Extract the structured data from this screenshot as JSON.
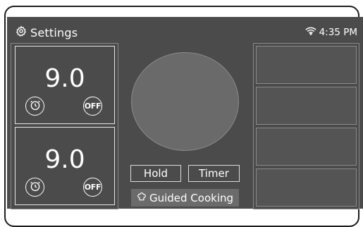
{
  "header": {
    "settings_label": "Settings",
    "time": "4:35 PM",
    "settings_icon": "gear-icon",
    "status_icon": "wifi-icon"
  },
  "burners": [
    {
      "level": "9.0",
      "timer_icon": "timer-icon",
      "off_label": "OFF"
    },
    {
      "level": "9.0",
      "timer_icon": "timer-icon",
      "off_label": "OFF"
    }
  ],
  "controls": {
    "hold_label": "Hold",
    "timer_label": "Timer",
    "guided_label": "Guided Cooking",
    "guided_icon": "chef-hat-icon"
  },
  "right_slots": [
    "",
    "",
    "",
    ""
  ],
  "colors": {
    "screen_bg": "#4b4b4b",
    "circle_fill": "#6a6a6a",
    "guided_bg": "#6b6b6b",
    "text": "#ffffff"
  }
}
